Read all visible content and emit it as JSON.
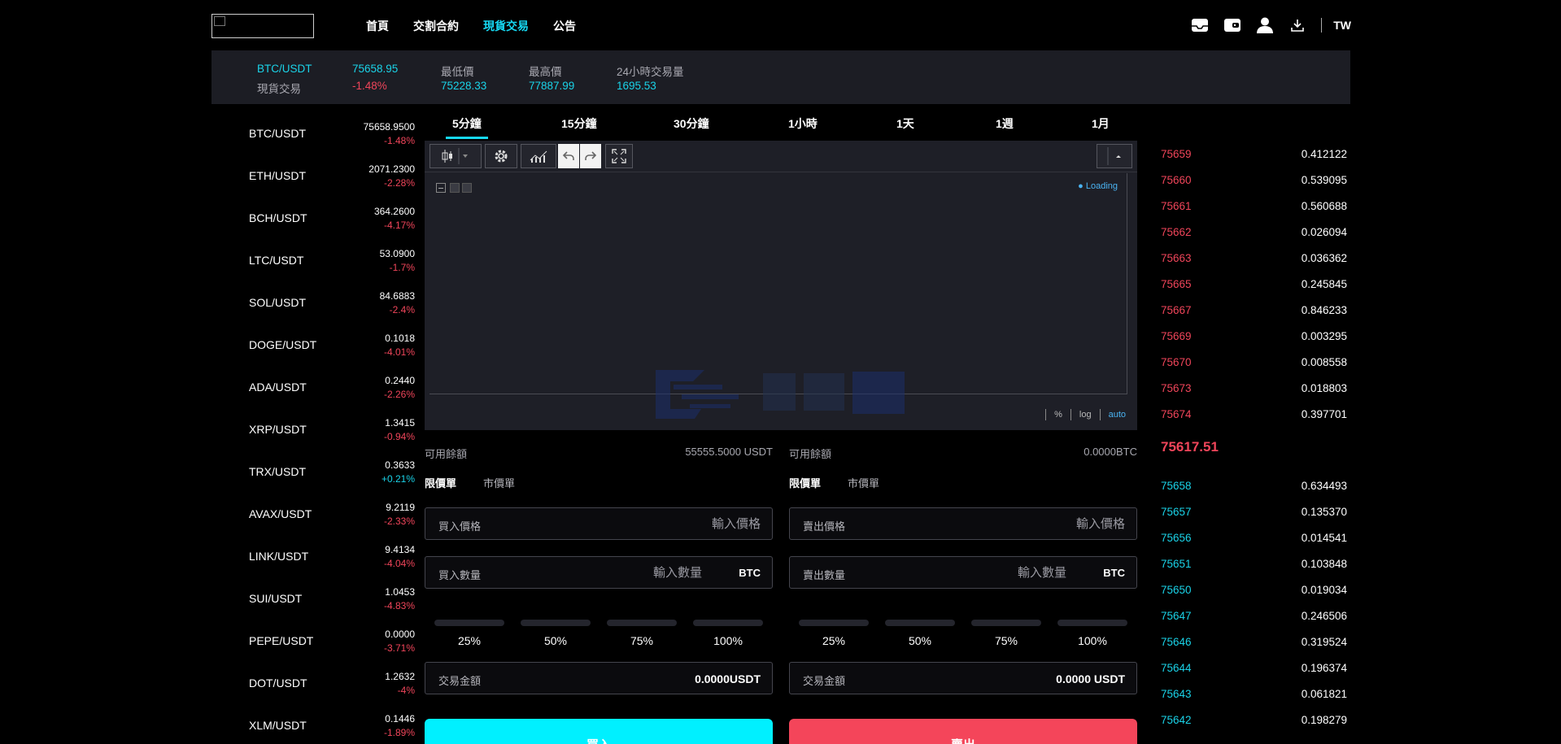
{
  "nav": {
    "links": [
      "首頁",
      "交割合約",
      "現貨交易",
      "公告"
    ],
    "active_index": 2,
    "lang": "TW",
    "icons": [
      "inbox-icon",
      "wallet-icon",
      "user-icon",
      "download-icon"
    ]
  },
  "ticker": {
    "pair": "BTC/USDT",
    "market_type": "現貨交易",
    "last_price": "75658.95",
    "change": "-1.48%",
    "low_label": "最低價",
    "low": "75228.33",
    "high_label": "最高價",
    "high": "77887.99",
    "volume_label": "24小時交易量",
    "volume": "1695.53"
  },
  "markets": [
    {
      "symbol": "BTC/USDT",
      "price": "75658.9500",
      "change": "-1.48%",
      "up": false
    },
    {
      "symbol": "ETH/USDT",
      "price": "2071.2300",
      "change": "-2.28%",
      "up": false
    },
    {
      "symbol": "BCH/USDT",
      "price": "364.2600",
      "change": "-4.17%",
      "up": false
    },
    {
      "symbol": "LTC/USDT",
      "price": "53.0900",
      "change": "-1.7%",
      "up": false
    },
    {
      "symbol": "SOL/USDT",
      "price": "84.6883",
      "change": "-2.4%",
      "up": false
    },
    {
      "symbol": "DOGE/USDT",
      "price": "0.1018",
      "change": "-4.01%",
      "up": false
    },
    {
      "symbol": "ADA/USDT",
      "price": "0.2440",
      "change": "-2.26%",
      "up": false
    },
    {
      "symbol": "XRP/USDT",
      "price": "1.3415",
      "change": "-0.94%",
      "up": false
    },
    {
      "symbol": "TRX/USDT",
      "price": "0.3633",
      "change": "+0.21%",
      "up": true
    },
    {
      "symbol": "AVAX/USDT",
      "price": "9.2119",
      "change": "-2.33%",
      "up": false
    },
    {
      "symbol": "LINK/USDT",
      "price": "9.4134",
      "change": "-4.04%",
      "up": false
    },
    {
      "symbol": "SUI/USDT",
      "price": "1.0453",
      "change": "-4.83%",
      "up": false
    },
    {
      "symbol": "PEPE/USDT",
      "price": "0.0000",
      "change": "-3.71%",
      "up": false
    },
    {
      "symbol": "DOT/USDT",
      "price": "1.2632",
      "change": "-4%",
      "up": false
    },
    {
      "symbol": "XLM/USDT",
      "price": "0.1446",
      "change": "-1.89%",
      "up": false
    }
  ],
  "timeframes": [
    "5分鐘",
    "15分鐘",
    "30分鐘",
    "1小時",
    "1天",
    "1週",
    "1月"
  ],
  "timeframe_active": 0,
  "chart": {
    "loading_text": "Loading",
    "scale_percent": "%",
    "scale_log": "log",
    "scale_auto": "auto",
    "toolbar_icons": [
      "candlestick-icon",
      "dropdown-icon",
      "settings-icon",
      "indicators-icon",
      "undo-icon",
      "redo-icon",
      "fullscreen-icon",
      "compare-icon"
    ]
  },
  "buy": {
    "avail_label": "可用餘額",
    "avail_value": "55555.5000 USDT",
    "type_limit": "限價單",
    "type_market": "市價單",
    "price_label": "買入價格",
    "price_placeholder": "輸入價格",
    "qty_label": "買入數量",
    "qty_placeholder": "輸入數量",
    "qty_unit": "BTC",
    "percents": [
      "25%",
      "50%",
      "75%",
      "100%"
    ],
    "amount_label": "交易金額",
    "amount_value": "0.0000USDT",
    "button": "買入"
  },
  "sell": {
    "avail_label": "可用餘額",
    "avail_value": "0.0000BTC",
    "type_limit": "限價單",
    "type_market": "市價單",
    "price_label": "賣出價格",
    "price_placeholder": "輸入價格",
    "qty_label": "賣出數量",
    "qty_placeholder": "輸入數量",
    "qty_unit": "BTC",
    "percents": [
      "25%",
      "50%",
      "75%",
      "100%"
    ],
    "amount_label": "交易金額",
    "amount_value": "0.0000 USDT",
    "button": "賣出"
  },
  "orderbook": {
    "asks": [
      {
        "price": "75659",
        "qty": "0.412122"
      },
      {
        "price": "75660",
        "qty": "0.539095"
      },
      {
        "price": "75661",
        "qty": "0.560688"
      },
      {
        "price": "75662",
        "qty": "0.026094"
      },
      {
        "price": "75663",
        "qty": "0.036362"
      },
      {
        "price": "75665",
        "qty": "0.245845"
      },
      {
        "price": "75667",
        "qty": "0.846233"
      },
      {
        "price": "75669",
        "qty": "0.003295"
      },
      {
        "price": "75670",
        "qty": "0.008558"
      },
      {
        "price": "75673",
        "qty": "0.018803"
      },
      {
        "price": "75674",
        "qty": "0.397701"
      }
    ],
    "mid_price": "75617.51",
    "bids": [
      {
        "price": "75658",
        "qty": "0.634493"
      },
      {
        "price": "75657",
        "qty": "0.135370"
      },
      {
        "price": "75656",
        "qty": "0.014541"
      },
      {
        "price": "75651",
        "qty": "0.103848"
      },
      {
        "price": "75650",
        "qty": "0.019034"
      },
      {
        "price": "75647",
        "qty": "0.246506"
      },
      {
        "price": "75646",
        "qty": "0.319524"
      },
      {
        "price": "75644",
        "qty": "0.196374"
      },
      {
        "price": "75643",
        "qty": "0.061821"
      },
      {
        "price": "75642",
        "qty": "0.198279"
      }
    ]
  },
  "colors": {
    "accent": "#16d8f2",
    "up": "#1ad3e8",
    "down": "#f0455a",
    "buy_button": "#00f0ff",
    "sell_button": "#f4455a"
  }
}
